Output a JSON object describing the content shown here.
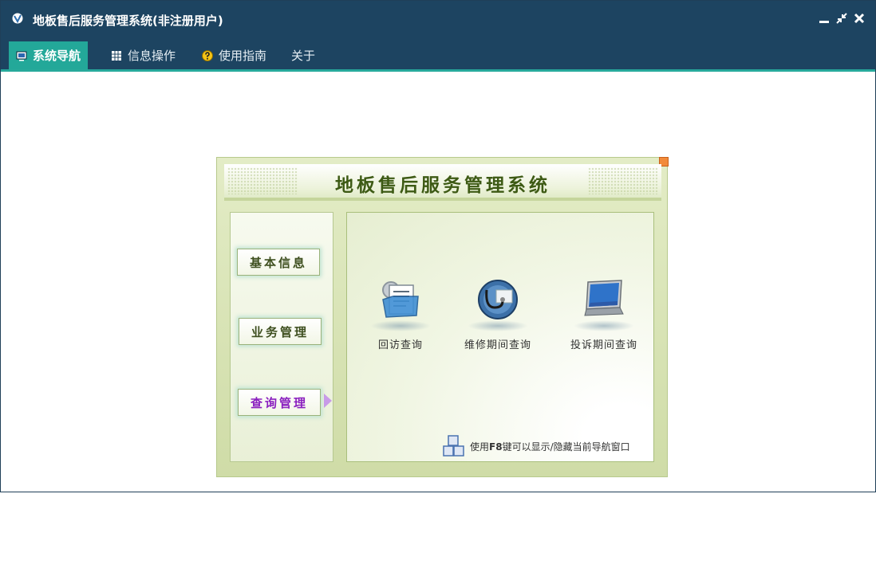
{
  "window": {
    "title": "地板售后服务管理系统(非注册用户)"
  },
  "menu": {
    "items": [
      {
        "label": "系统导航",
        "icon": "monitor-icon"
      },
      {
        "label": "信息操作",
        "icon": "grid-icon"
      },
      {
        "label": "使用指南",
        "icon": "help-icon"
      },
      {
        "label": "关于"
      }
    ]
  },
  "nav": {
    "title": "地板售后服务管理系统",
    "categories": [
      "基本信息",
      "业务管理",
      "查询管理"
    ],
    "selected_category": "查询管理",
    "functions": [
      {
        "label": "回访查询",
        "icon": "folder-document-icon"
      },
      {
        "label": "维修期间查询",
        "icon": "stethoscope-icon"
      },
      {
        "label": "投诉期间查询",
        "icon": "laptop-icon"
      }
    ],
    "hint": {
      "pre": "使用",
      "key": "F8",
      "post": "键可以显示/隐藏当前导航窗口"
    }
  },
  "colors": {
    "title_bar": "#1d4461",
    "active_tab": "#23a899",
    "nav_title": "#3d5a14",
    "selected_category": "#8a1fbf"
  }
}
